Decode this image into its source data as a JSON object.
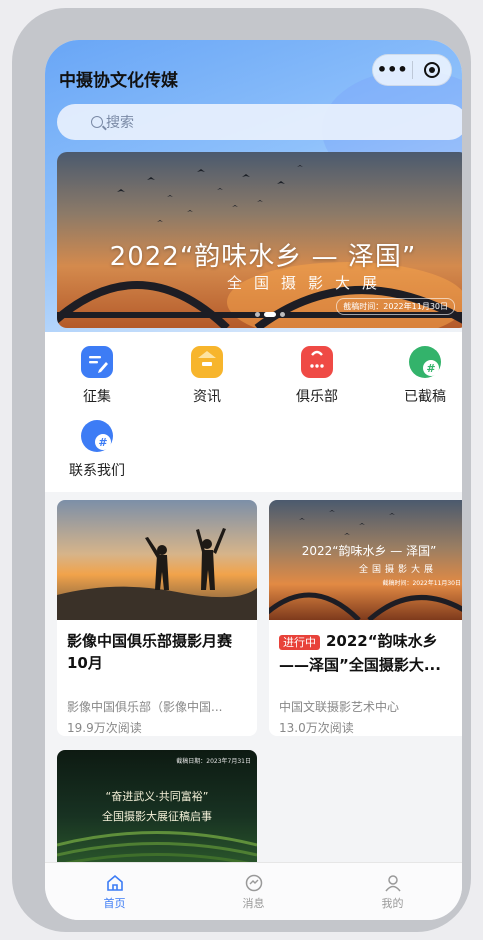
{
  "app": {
    "title": "中摄协文化传媒"
  },
  "capsule": {
    "more": "•••"
  },
  "search": {
    "placeholder": "搜索"
  },
  "banner": {
    "title": "2022“韵味水乡 — 泽国”",
    "subtitle": "全国摄影大展",
    "deadline": "截稿时间：2022年11月30日"
  },
  "menu": {
    "items": [
      {
        "label": "征集",
        "icon": "edit-doc-icon",
        "color": "#3d7cf5"
      },
      {
        "label": "资讯",
        "icon": "news-bookmark-icon",
        "color": "#f7b52c"
      },
      {
        "label": "俱乐部",
        "icon": "club-bag-icon",
        "color": "#ef4a45"
      },
      {
        "label": "已截稿",
        "icon": "chat-hash-icon",
        "color": "#33b36b"
      },
      {
        "label": "联系我们",
        "icon": "chat-hash-icon",
        "color": "#3d7cf5"
      }
    ]
  },
  "feed": {
    "cards": [
      {
        "title": "影像中国俱乐部摄影月赛10月",
        "source": "影像中国俱乐部（影像中国...",
        "reads": "19.9万次阅读"
      },
      {
        "tag": "进行中",
        "title": "2022“韵味水乡——泽国”全国摄影大...",
        "source": "中国文联摄影艺术中心",
        "reads": "13.0万次阅读",
        "image_text": {
          "title": "2022“韵味水乡 — 泽国”",
          "subtitle": "全国摄影大展",
          "deadline": "截稿时间：2022年11月30日"
        }
      },
      {
        "image_text": {
          "line1": "“奋进武义·共同富裕”",
          "line2": "全国摄影大展征稿启事",
          "deadline": "截稿日期：2023年7月31日"
        }
      }
    ]
  },
  "tabbar": {
    "tabs": [
      {
        "label": "首页",
        "icon": "home-icon",
        "active": true
      },
      {
        "label": "消息",
        "icon": "message-icon",
        "active": false
      },
      {
        "label": "我的",
        "icon": "user-icon",
        "active": false
      }
    ]
  },
  "colors": {
    "accent": "#3d7cf5",
    "tag_red": "#e8423a"
  }
}
